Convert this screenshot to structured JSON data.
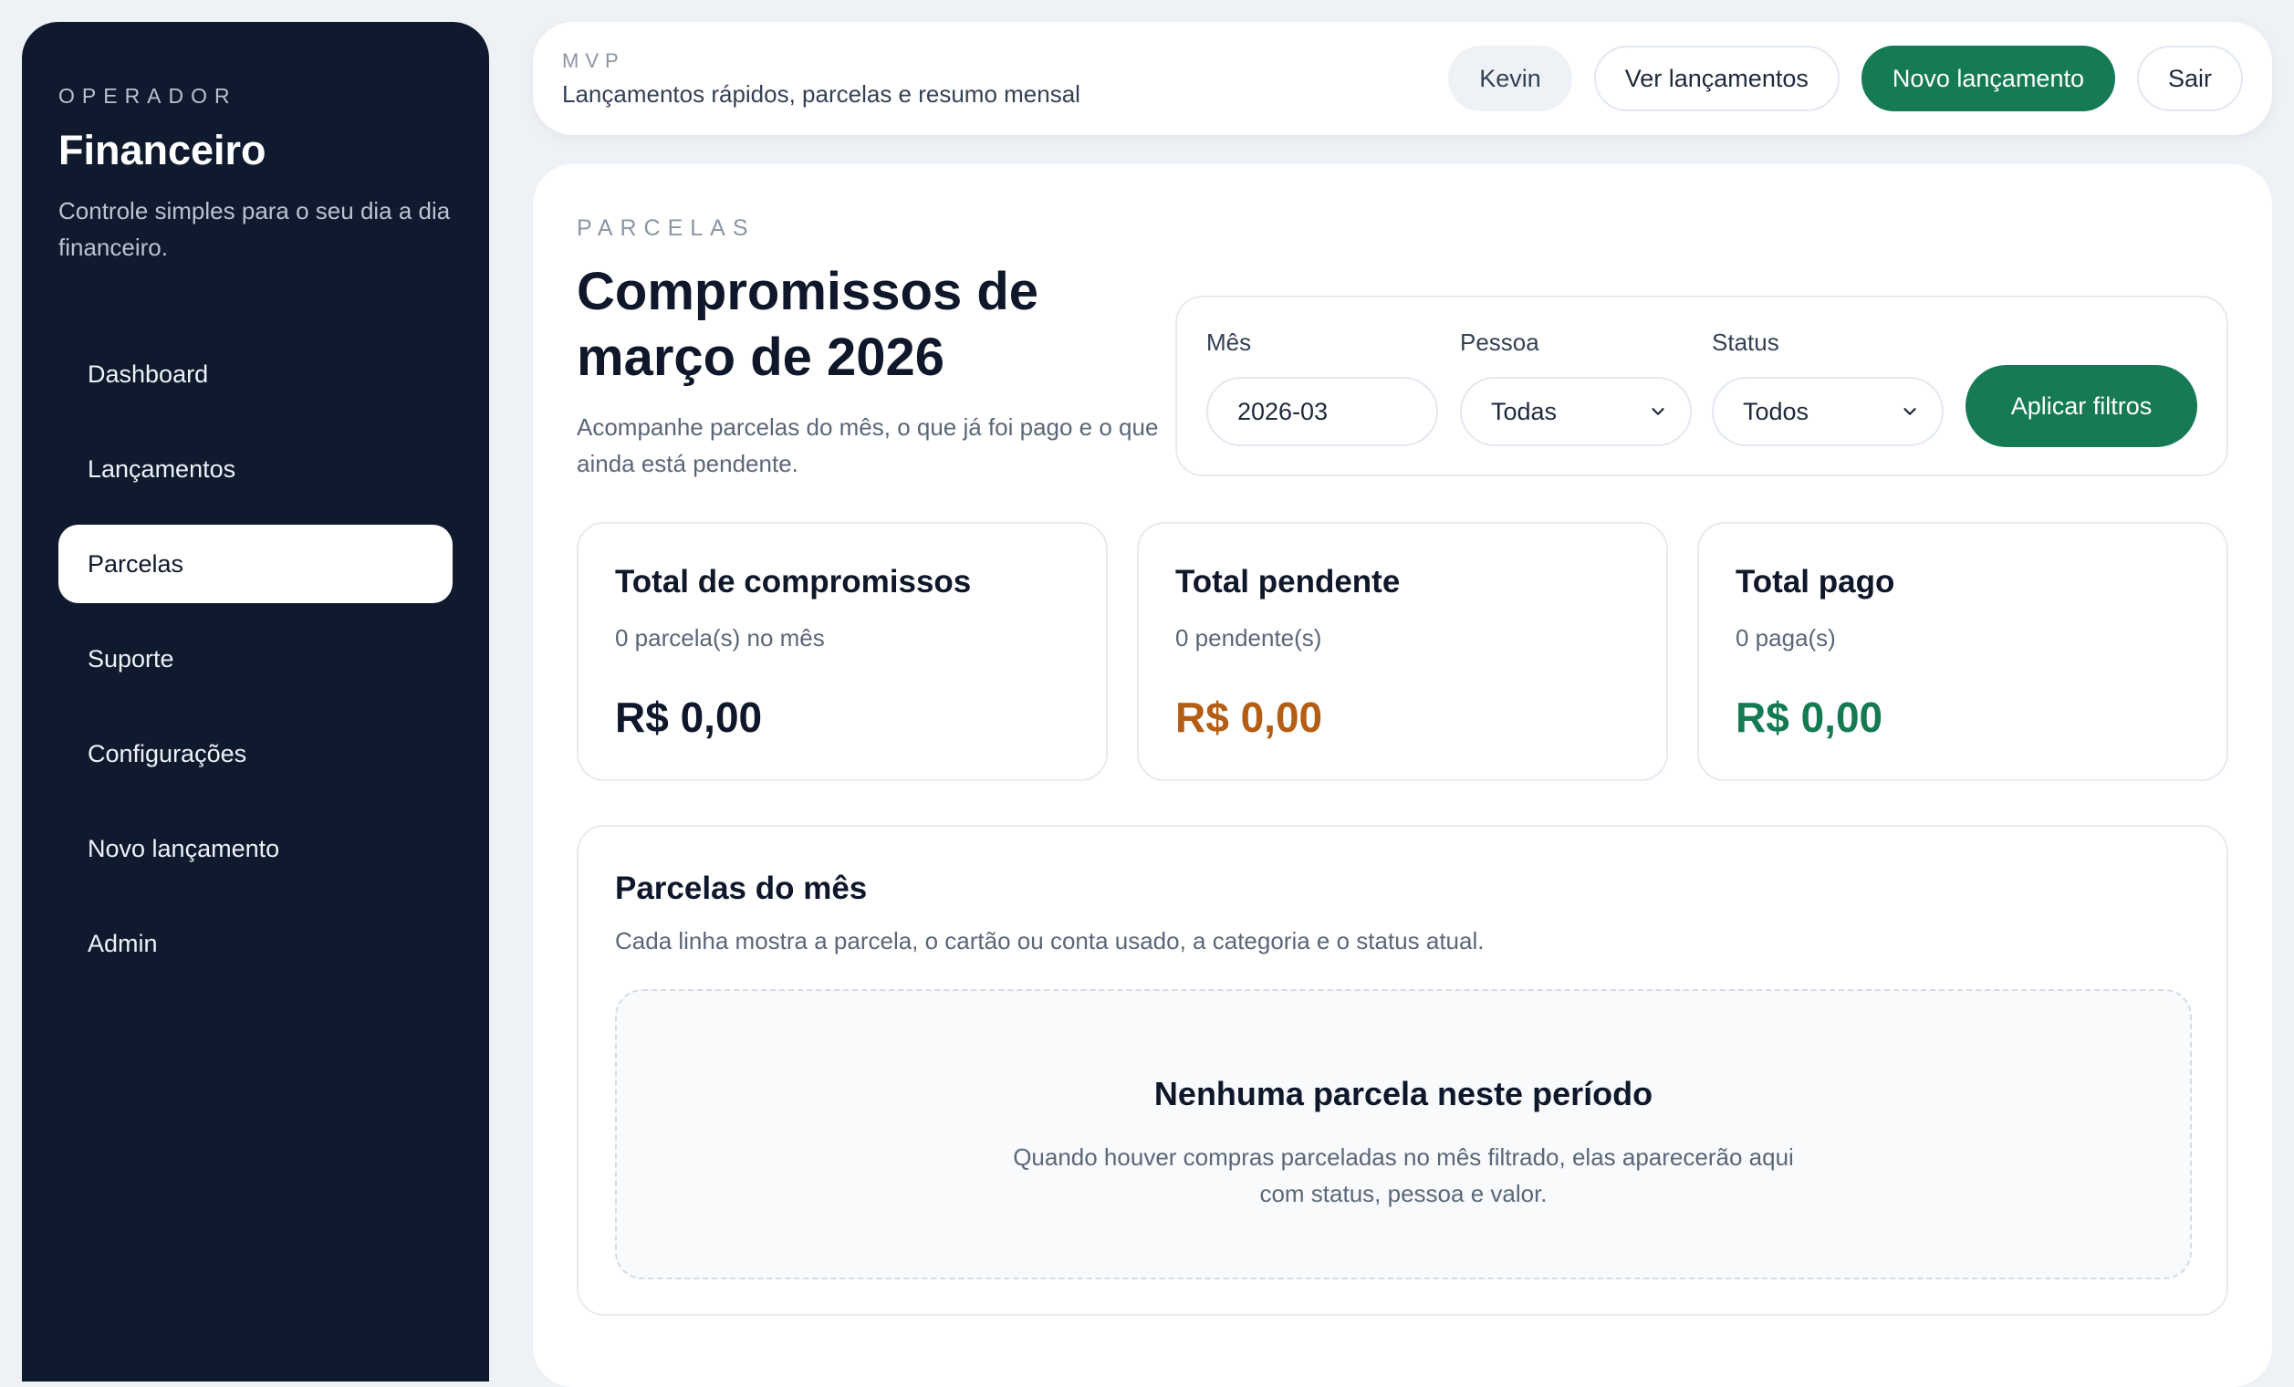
{
  "sidebar": {
    "eyebrow": "OPERADOR",
    "title": "Financeiro",
    "description": "Controle simples para o seu dia a dia financeiro.",
    "items": [
      {
        "label": "Dashboard",
        "active": false
      },
      {
        "label": "Lançamentos",
        "active": false
      },
      {
        "label": "Parcelas",
        "active": true
      },
      {
        "label": "Suporte",
        "active": false
      },
      {
        "label": "Configurações",
        "active": false
      },
      {
        "label": "Novo lançamento",
        "active": false
      },
      {
        "label": "Admin",
        "active": false
      }
    ]
  },
  "topbar": {
    "eyebrow": "MVP",
    "subtitle": "Lançamentos rápidos, parcelas e resumo mensal",
    "user": "Kevin",
    "view_entries": "Ver lançamentos",
    "new_entry": "Novo lançamento",
    "logout": "Sair"
  },
  "page": {
    "eyebrow": "PARCELAS",
    "title": "Compromissos de março de 2026",
    "description": "Acompanhe parcelas do mês, o que já foi pago e o que ainda está pendente."
  },
  "filters": {
    "month_label": "Mês",
    "month_value": "2026-03",
    "person_label": "Pessoa",
    "person_value": "Todas",
    "status_label": "Status",
    "status_value": "Todos",
    "apply_label": "Aplicar filtros"
  },
  "stats": [
    {
      "title": "Total de compromissos",
      "subtitle": "0 parcela(s) no mês",
      "value": "R$ 0,00",
      "color": "#0f172a"
    },
    {
      "title": "Total pendente",
      "subtitle": "0 pendente(s)",
      "value": "R$ 0,00",
      "color": "#b45d14"
    },
    {
      "title": "Total pago",
      "subtitle": "0 paga(s)",
      "value": "R$ 0,00",
      "color": "#157a52"
    }
  ],
  "installments": {
    "title": "Parcelas do mês",
    "subtitle": "Cada linha mostra a parcela, o cartão ou conta usado, a categoria e o status atual.",
    "empty_title": "Nenhuma parcela neste período",
    "empty_description": "Quando houver compras parceladas no mês filtrado, elas aparecerão aqui com status, pessoa e valor."
  },
  "colors": {
    "sidebar_bg": "#0f1a2e",
    "accent": "#167a55",
    "pending": "#b45d14",
    "paid": "#157a52"
  }
}
